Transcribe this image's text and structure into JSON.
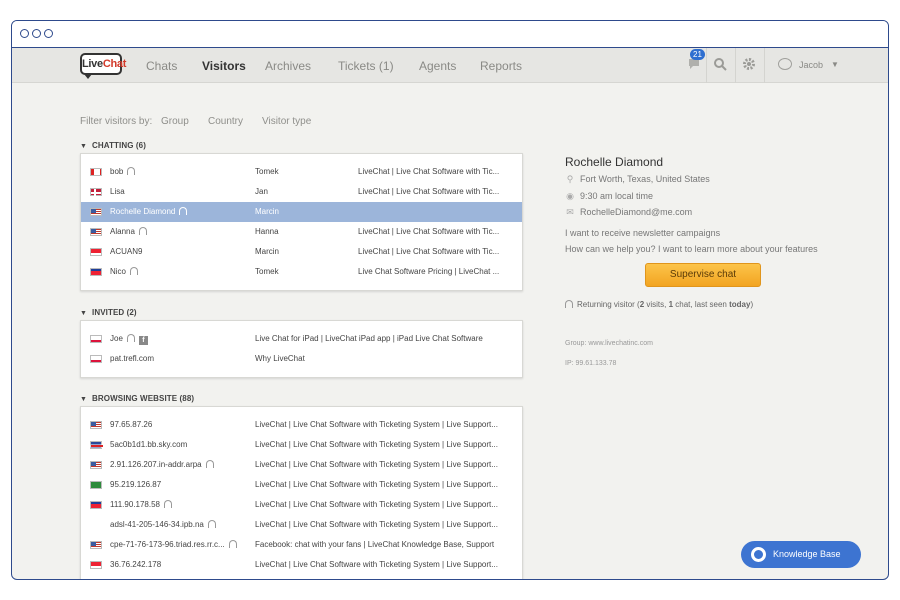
{
  "nav": {
    "tabs": [
      {
        "label": "Chats",
        "active": false
      },
      {
        "label": "Visitors",
        "active": true
      },
      {
        "label": "Archives",
        "active": false
      },
      {
        "label": "Tickets (1)",
        "active": false
      },
      {
        "label": "Agents",
        "active": false
      },
      {
        "label": "Reports",
        "active": false
      }
    ],
    "notification_count": "21",
    "user_name": "Jacob",
    "user_arrow": "▼"
  },
  "filter": {
    "label": "Filter visitors by:",
    "options": [
      "Group",
      "Country",
      "Visitor type"
    ]
  },
  "sections": {
    "chatting": {
      "title": "CHATTING (6)",
      "rows": [
        {
          "flag": "ca",
          "name": "bob",
          "headset": true,
          "agent": "Tomek",
          "page": "LiveChat | Live Chat Software with Tic...",
          "selected": false
        },
        {
          "flag": "dk",
          "name": "Lisa",
          "headset": false,
          "agent": "Jan",
          "page": "LiveChat | Live Chat Software with Tic...",
          "selected": false
        },
        {
          "flag": "us",
          "name": "Rochelle Diamond",
          "headset": true,
          "agent": "Marcin",
          "page": "",
          "selected": true
        },
        {
          "flag": "us",
          "name": "Alanna",
          "headset": true,
          "agent": "Hanna",
          "page": "LiveChat | Live Chat Software with Tic...",
          "selected": false
        },
        {
          "flag": "id",
          "name": "ACUAN9",
          "headset": false,
          "agent": "Marcin",
          "page": "LiveChat | Live Chat Software with Tic...",
          "selected": false
        },
        {
          "flag": "kh",
          "name": "Nico",
          "headset": true,
          "agent": "Tomek",
          "page": "Live Chat Software Pricing | LiveChat ...",
          "selected": false
        }
      ]
    },
    "invited": {
      "title": "INVITED (2)",
      "rows": [
        {
          "flag": "pl",
          "name": "Joe",
          "headset": true,
          "facebook": true,
          "page": "Live Chat for iPad | LiveChat iPad app | iPad Live Chat Software"
        },
        {
          "flag": "pl",
          "name": "pat.trefl.com",
          "headset": false,
          "facebook": false,
          "page": "Why LiveChat"
        }
      ]
    },
    "browsing": {
      "title": "BROWSING WEBSITE (88)",
      "rows": [
        {
          "flag": "us",
          "name": "97.65.87.26",
          "headset": false,
          "page": "LiveChat | Live Chat Software with Ticketing System | Live Support..."
        },
        {
          "flag": "gb",
          "name": "5ac0b1d1.bb.sky.com",
          "headset": false,
          "page": "LiveChat | Live Chat Software with Ticketing System | Live Support..."
        },
        {
          "flag": "us",
          "name": "2.91.126.207.in-addr.arpa",
          "headset": true,
          "page": "LiveChat | Live Chat Software with Ticketing System | Live Support..."
        },
        {
          "flag": "sa",
          "name": "95.219.126.87",
          "headset": false,
          "page": "LiveChat | Live Chat Software with Ticketing System | Live Support..."
        },
        {
          "flag": "kh",
          "name": "111.90.178.58",
          "headset": true,
          "page": "LiveChat | Live Chat Software with Ticketing System | Live Support..."
        },
        {
          "flag": "none",
          "name": "adsl-41-205-146-34.ipb.na",
          "headset": true,
          "page": "LiveChat | Live Chat Software with Ticketing System | Live Support..."
        },
        {
          "flag": "us",
          "name": "cpe-71-76-173-96.triad.res.rr.c...",
          "headset": true,
          "page": "Facebook: chat with your fans | LiveChat Knowledge Base, Support"
        },
        {
          "flag": "id",
          "name": "36.76.242.178",
          "headset": false,
          "page": "LiveChat | Live Chat Software with Ticketing System | Live Support..."
        }
      ]
    }
  },
  "detail": {
    "name": "Rochelle Diamond",
    "location": "Fort Worth, Texas, United States",
    "local_time": "9:30 am local time",
    "email": "RochelleDiamond@me.com",
    "message_1": "I want to receive newsletter campaigns",
    "message_2": "How can we help you? I want to learn more about your features",
    "supervise_label": "Supervise chat",
    "returning_label": "Returning visitor",
    "returning_visits": "2",
    "returning_chats": "1",
    "returning_last_seen": "today",
    "group": "Group: www.livechatinc.com",
    "ip": "IP: 99.61.133.78"
  },
  "knowledge_base": {
    "label": "Knowledge Base"
  },
  "colors": {
    "accent": "#3d74d1",
    "frame": "#2e4a8c",
    "selected_row": "#9cb5da",
    "supervise": "#f5b02e"
  }
}
